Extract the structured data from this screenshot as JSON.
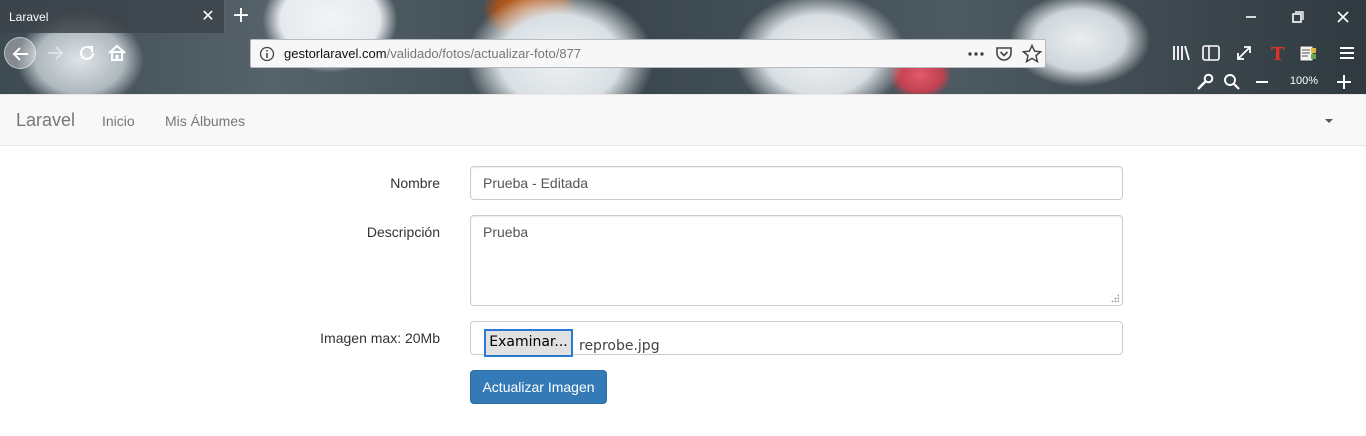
{
  "browser": {
    "tab_title": "Laravel",
    "url_host": "gestorlaravel.com",
    "url_path": "/validado/fotos/actualizar-foto/877",
    "zoom": "100%"
  },
  "navbar": {
    "brand": "Laravel",
    "links": [
      "Inicio",
      "Mis Álbumes"
    ]
  },
  "form": {
    "nombre_label": "Nombre",
    "nombre_value": "Prueba - Editada",
    "descripcion_label": "Descripción",
    "descripcion_value": "Prueba",
    "imagen_label": "Imagen max: 20Mb",
    "file_button": "Examinar...",
    "file_name": "reprobe.jpg",
    "submit": "Actualizar Imagen"
  },
  "colors": {
    "primary_button": "#337ab7",
    "navbar_bg": "#f8f8f8"
  }
}
